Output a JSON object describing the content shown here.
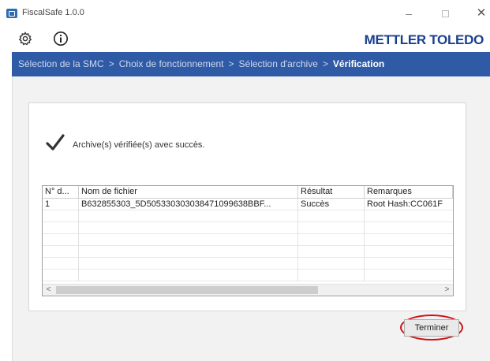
{
  "window": {
    "title": "FiscalSafe 1.0.0",
    "minimize_glyph": "–",
    "close_glyph": "✕"
  },
  "toolbar": {
    "settings_icon": "gear-icon",
    "info_icon": "info-icon",
    "brand": "METTLER TOLEDO"
  },
  "breadcrumb": {
    "items": [
      "Sélection de la SMC",
      "Choix de fonctionnement",
      "Sélection d'archive",
      "Vérification"
    ],
    "separator": ">",
    "active_index": 3
  },
  "status": {
    "icon": "checkmark-icon",
    "message": "Archive(s) vérifiée(s) avec succès."
  },
  "table": {
    "columns": [
      "N° d...",
      "Nom de fichier",
      "Résultat",
      "Remarques"
    ],
    "rows": [
      [
        "1",
        "B632855303_5D505330303038471099638BBF...",
        "Succès",
        "Root Hash:CC061F"
      ]
    ],
    "scroll_left": "<",
    "scroll_right": ">"
  },
  "footer": {
    "finish_label": "Terminer"
  },
  "colors": {
    "accent": "#2e5aa6",
    "brand": "#1b3f8f",
    "highlight": "#d0101a"
  }
}
